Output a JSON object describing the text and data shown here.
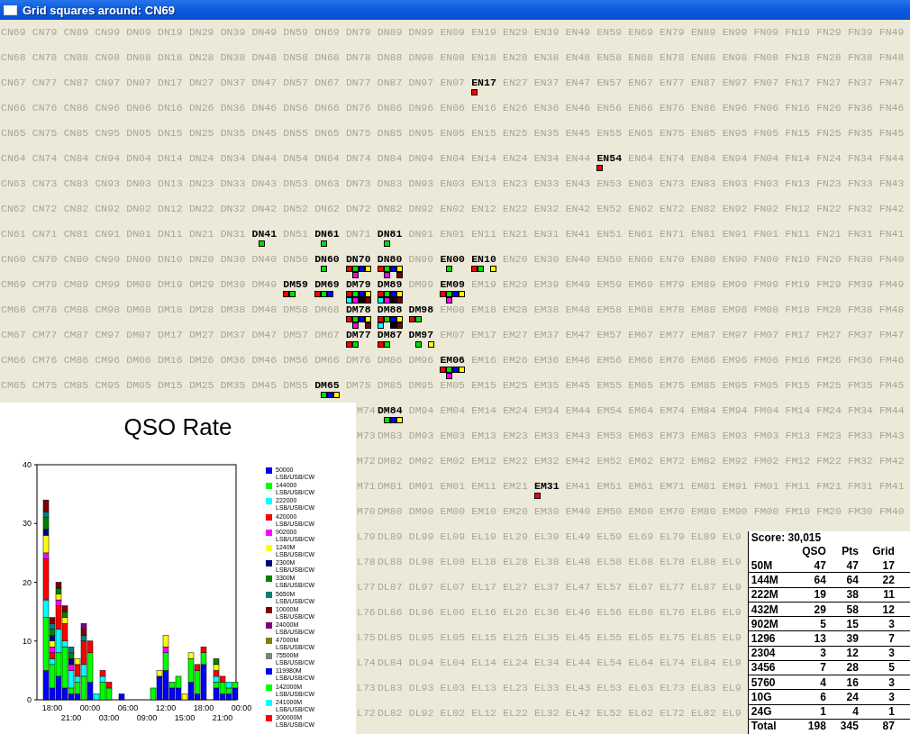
{
  "window": {
    "title": "Grid squares around: CN69"
  },
  "grid": {
    "top_rows": [
      [
        "CN69",
        "CN79",
        "CN89",
        "CN99",
        "DN09",
        "DN19",
        "DN29",
        "DN39",
        "DN49",
        "DN59",
        "DN69",
        "DN79",
        "DN89",
        "DN99",
        "EN09",
        "EN19",
        "EN29",
        "EN39",
        "EN49",
        "EN59",
        "EN69",
        "EN79",
        "EN89",
        "EN99",
        "FN09",
        "FN19",
        "FN29",
        "FN39",
        "FN49"
      ],
      [
        "CN68",
        "CN78",
        "CN88",
        "CN98",
        "DN08",
        "DN18",
        "DN28",
        "DN38",
        "DN48",
        "DN58",
        "DN68",
        "DN78",
        "DN88",
        "DN98",
        "EN08",
        "EN18",
        "EN28",
        "EN38",
        "EN48",
        "EN58",
        "EN68",
        "EN78",
        "EN88",
        "EN98",
        "FN08",
        "FN18",
        "FN28",
        "FN38",
        "FN48"
      ],
      [
        "CN67",
        "CN77",
        "CN87",
        "CN97",
        "DN07",
        "DN17",
        "DN27",
        "DN37",
        "DN47",
        "DN57",
        "DN67",
        "DN77",
        "DN87",
        "DN97",
        "EN07",
        {
          "label": "EN17",
          "marks": [
            {
              "kind": "square",
              "color": "#ff0000"
            }
          ]
        },
        "EN27",
        "EN37",
        "EN47",
        "EN57",
        "EN67",
        "EN77",
        "EN87",
        "EN97",
        "FN07",
        "FN17",
        "FN27",
        "FN37",
        "FN47"
      ],
      [
        "CN66",
        "CN76",
        "CN86",
        "CN96",
        "DN06",
        "DN16",
        "DN26",
        "DN36",
        "DN46",
        "DN56",
        "DN66",
        "DN76",
        "DN86",
        "DN96",
        "EN06",
        "EN16",
        "EN26",
        "EN36",
        "EN46",
        "EN56",
        "EN66",
        "EN76",
        "EN86",
        "EN96",
        "FN06",
        "FN16",
        "FN26",
        "FN36",
        "FN46"
      ],
      [
        "CN65",
        "CN75",
        "CN85",
        "CN95",
        "DN05",
        "DN15",
        "DN25",
        "DN35",
        "DN45",
        "DN55",
        "DN65",
        "DN75",
        "DN85",
        "DN95",
        "EN05",
        "EN15",
        "EN25",
        "EN35",
        "EN45",
        "EN55",
        "EN65",
        "EN75",
        "EN85",
        "EN95",
        "FN05",
        "FN15",
        "FN25",
        "FN35",
        "FN45"
      ],
      [
        "CN64",
        "CN74",
        "CN84",
        "CN94",
        "DN04",
        "DN14",
        "DN24",
        "DN34",
        "DN44",
        "DN54",
        "DN64",
        "DN74",
        "DN84",
        "DN94",
        "EN04",
        "EN14",
        "EN24",
        "EN34",
        "EN44",
        {
          "label": "EN54",
          "marks": [
            {
              "kind": "square",
              "color": "#ff0000"
            }
          ]
        },
        "EN64",
        "EN74",
        "EN84",
        "EN94",
        "FN04",
        "FN14",
        "FN24",
        "FN34",
        "FN44"
      ],
      [
        "CN63",
        "CN73",
        "CN83",
        "CN93",
        "DN03",
        "DN13",
        "DN23",
        "DN33",
        "DN43",
        "DN53",
        "DN63",
        "DN73",
        "DN83",
        "DN93",
        "EN03",
        "EN13",
        "EN23",
        "EN33",
        "EN43",
        "EN53",
        "EN63",
        "EN73",
        "EN83",
        "EN93",
        "FN03",
        "FN13",
        "FN23",
        "FN33",
        "FN43"
      ],
      [
        "CN62",
        "CN72",
        "CN82",
        "CN92",
        "DN02",
        "DN12",
        "DN22",
        "DN32",
        "DN42",
        "DN52",
        "DN62",
        "DN72",
        "DN82",
        "DN92",
        "EN02",
        "EN12",
        "EN22",
        "EN32",
        "EN42",
        "EN52",
        "EN62",
        "EN72",
        "EN82",
        "EN92",
        "FN02",
        "FN12",
        "FN22",
        "FN32",
        "FN42"
      ],
      [
        "CN61",
        "CN71",
        "CN81",
        "CN91",
        "DN01",
        "DN11",
        "DN21",
        "DN31",
        {
          "label": "DN41",
          "marks": [
            {
              "kind": "gap"
            },
            {
              "kind": "square",
              "color": "#00e000"
            }
          ]
        },
        "DN51",
        {
          "label": "DN61",
          "marks": [
            {
              "kind": "gap"
            },
            {
              "kind": "square",
              "color": "#00e000"
            }
          ]
        },
        "DN71",
        {
          "label": "DN81",
          "marks": [
            {
              "kind": "gap"
            },
            {
              "kind": "square",
              "color": "#00e000"
            }
          ]
        },
        "DN91",
        "EN01",
        "EN11",
        "EN21",
        "EN31",
        "EN41",
        "EN51",
        "EN61",
        "EN71",
        "EN81",
        "EN91",
        "FN01",
        "FN11",
        "FN21",
        "FN31",
        "FN41"
      ],
      [
        "CN60",
        "CN70",
        "CN80",
        "CN90",
        "DN00",
        "DN10",
        "DN20",
        "DN30",
        "DN40",
        "DN50",
        {
          "label": "DN60",
          "marks": [
            {
              "kind": "gap"
            },
            {
              "kind": "square",
              "color": "#00e000"
            }
          ]
        },
        {
          "label": "DN70",
          "marks": [
            {
              "kind": "square",
              "color": "#ff0000"
            },
            {
              "kind": "square",
              "color": "#00e000"
            },
            {
              "kind": "square",
              "color": "#0000ff"
            },
            {
              "kind": "square",
              "color": "#ffff00"
            },
            {
              "kind": "gap"
            },
            {
              "kind": "square",
              "color": "#ff00ff"
            }
          ]
        },
        {
          "label": "DN80",
          "marks": [
            {
              "kind": "square",
              "color": "#ff0000"
            },
            {
              "kind": "square",
              "color": "#00e000"
            },
            {
              "kind": "square",
              "color": "#0000ff"
            },
            {
              "kind": "square",
              "color": "#ffff00"
            },
            {
              "kind": "gap"
            },
            {
              "kind": "square",
              "color": "#ff00ff"
            },
            {
              "kind": "gap"
            },
            {
              "kind": "square",
              "color": "#800000"
            }
          ]
        },
        "DN90",
        {
          "label": "EN00",
          "marks": [
            {
              "kind": "gap"
            },
            {
              "kind": "square",
              "color": "#00e000"
            }
          ]
        },
        {
          "label": "EN10",
          "marks": [
            {
              "kind": "square",
              "color": "#ff0000"
            },
            {
              "kind": "square",
              "color": "#00e000"
            },
            {
              "kind": "gap"
            },
            {
              "kind": "square",
              "color": "#ffff00"
            }
          ]
        },
        "EN20",
        "EN30",
        "EN40",
        "EN50",
        "EN60",
        "EN70",
        "EN80",
        "EN90",
        "FN00",
        "FN10",
        "FN20",
        "FN30",
        "FN40"
      ],
      [
        "CM69",
        "CM79",
        "CM89",
        "CM99",
        "DM09",
        "DM19",
        "DM29",
        "DM39",
        "DM49",
        {
          "label": "DM59",
          "marks": [
            {
              "kind": "square",
              "color": "#ff0000"
            },
            {
              "kind": "square",
              "color": "#00e000"
            }
          ]
        },
        {
          "label": "DM69",
          "marks": [
            {
              "kind": "square",
              "color": "#ff0000"
            },
            {
              "kind": "square",
              "color": "#00e000"
            },
            {
              "kind": "square",
              "color": "#0000ff"
            }
          ]
        },
        {
          "label": "DM79",
          "marks": [
            {
              "kind": "square",
              "color": "#ff0000"
            },
            {
              "kind": "square",
              "color": "#00e000"
            },
            {
              "kind": "square",
              "color": "#0000ff"
            },
            {
              "kind": "square",
              "color": "#ffff00"
            },
            {
              "kind": "square",
              "color": "#00ffff"
            },
            {
              "kind": "square",
              "color": "#ff00ff"
            },
            {
              "kind": "square",
              "color": "#000000"
            },
            {
              "kind": "square",
              "color": "#800000"
            }
          ]
        },
        {
          "label": "DM89",
          "marks": [
            {
              "kind": "square",
              "color": "#ff0000"
            },
            {
              "kind": "square",
              "color": "#00e000"
            },
            {
              "kind": "square",
              "color": "#0000ff"
            },
            {
              "kind": "square",
              "color": "#ffff00"
            },
            {
              "kind": "square",
              "color": "#00ffff"
            },
            {
              "kind": "square",
              "color": "#ff00ff"
            },
            {
              "kind": "square",
              "color": "#000000"
            },
            {
              "kind": "square",
              "color": "#800000"
            }
          ]
        },
        "DM99",
        {
          "label": "EM09",
          "marks": [
            {
              "kind": "square",
              "color": "#ff0000"
            },
            {
              "kind": "square",
              "color": "#00e000"
            },
            {
              "kind": "square",
              "color": "#0000ff"
            },
            {
              "kind": "square",
              "color": "#ffff00"
            },
            {
              "kind": "gap"
            },
            {
              "kind": "square",
              "color": "#ff00ff"
            }
          ]
        },
        "EM19",
        "EM29",
        "EM39",
        "EM49",
        "EM59",
        "EM69",
        "EM79",
        "EM89",
        "EM99",
        "FM09",
        "FM19",
        "FM29",
        "FM39",
        "FM49"
      ],
      [
        "CM68",
        "CM78",
        "CM88",
        "CM98",
        "DM08",
        "DM18",
        "DM28",
        "DM38",
        "DM48",
        "DM58",
        "DM68",
        {
          "label": "DM78",
          "marks": [
            {
              "kind": "square",
              "color": "#ff0000"
            },
            {
              "kind": "square",
              "color": "#00e000"
            },
            {
              "kind": "square",
              "color": "#0000ff"
            },
            {
              "kind": "square",
              "color": "#ffff00"
            },
            {
              "kind": "gap"
            },
            {
              "kind": "square",
              "color": "#ff00ff"
            },
            {
              "kind": "gap"
            },
            {
              "kind": "square",
              "color": "#800000"
            }
          ]
        },
        {
          "label": "DM88",
          "marks": [
            {
              "kind": "square",
              "color": "#ff0000"
            },
            {
              "kind": "square",
              "color": "#00e000"
            },
            {
              "kind": "square",
              "color": "#0000ff"
            },
            {
              "kind": "square",
              "color": "#ffff00"
            },
            {
              "kind": "square",
              "color": "#00ffff"
            },
            {
              "kind": "gap"
            },
            {
              "kind": "square",
              "color": "#000000"
            },
            {
              "kind": "square",
              "color": "#800000"
            }
          ]
        },
        {
          "label": "DM98",
          "marks": [
            {
              "kind": "square",
              "color": "#ff0000"
            },
            {
              "kind": "square",
              "color": "#00e000"
            }
          ]
        },
        "EM08",
        "EM18",
        "EM28",
        "EM38",
        "EM48",
        "EM58",
        "EM68",
        "EM78",
        "EM88",
        "EM98",
        "FM08",
        "FM18",
        "FM28",
        "FM38",
        "FM48"
      ],
      [
        "CM67",
        "CM77",
        "CM87",
        "CM97",
        "DM07",
        "DM17",
        "DM27",
        "DM37",
        "DM47",
        "DM57",
        "DM67",
        {
          "label": "DM77",
          "marks": [
            {
              "kind": "square",
              "color": "#ff0000"
            },
            {
              "kind": "square",
              "color": "#00e000"
            }
          ]
        },
        {
          "label": "DM87",
          "marks": [
            {
              "kind": "square",
              "color": "#ff0000"
            },
            {
              "kind": "square",
              "color": "#00e000"
            }
          ]
        },
        {
          "label": "DM97",
          "marks": [
            {
              "kind": "gap"
            },
            {
              "kind": "square",
              "color": "#00e000"
            },
            {
              "kind": "gap"
            },
            {
              "kind": "square",
              "color": "#ffff00"
            }
          ]
        },
        "EM07",
        "EM17",
        "EM27",
        "EM37",
        "EM47",
        "EM57",
        "EM67",
        "EM77",
        "EM87",
        "EM97",
        "FM07",
        "FM17",
        "FM27",
        "FM37",
        "FM47"
      ],
      [
        "CM66",
        "CM76",
        "CM86",
        "CM96",
        "DM06",
        "DM16",
        "DM26",
        "DM36",
        "DM46",
        "DM56",
        "DM66",
        "DM76",
        "DM86",
        "DM96",
        {
          "label": "EM06",
          "marks": [
            {
              "kind": "square",
              "color": "#ff0000"
            },
            {
              "kind": "square",
              "color": "#00e000"
            },
            {
              "kind": "square",
              "color": "#0000ff"
            },
            {
              "kind": "square",
              "color": "#ffff00"
            },
            {
              "kind": "gap"
            },
            {
              "kind": "square",
              "color": "#ff00ff"
            }
          ]
        },
        "EM16",
        "EM26",
        "EM36",
        "EM46",
        "EM56",
        "EM66",
        "EM76",
        "EM86",
        "EM96",
        "FM06",
        "FM16",
        "FM26",
        "FM36",
        "FM46"
      ],
      [
        "CM65",
        "CM75",
        "CM85",
        "CM95",
        "DM05",
        "DM15",
        "DM25",
        "DM35",
        "DM45",
        "DM55",
        {
          "label": "DM65",
          "marks": [
            {
              "kind": "gap"
            },
            {
              "kind": "square",
              "color": "#00e000"
            },
            {
              "kind": "square",
              "color": "#0000ff"
            },
            {
              "kind": "square",
              "color": "#ffff00"
            }
          ]
        },
        "DM75",
        "DM85",
        "DM95",
        "EM05",
        "EM15",
        "EM25",
        "EM35",
        "EM45",
        "EM55",
        "EM65",
        "EM75",
        "EM85",
        "EM95",
        "FM05",
        "FM15",
        "FM25",
        "FM35",
        "FM45"
      ]
    ],
    "lower_rows": [
      [
        "M74",
        {
          "label": "DM84",
          "marks": [
            {
              "kind": "gap"
            },
            {
              "kind": "square",
              "color": "#00e000"
            },
            {
              "kind": "square",
              "color": "#0000ff"
            },
            {
              "kind": "square",
              "color": "#ffff00"
            }
          ]
        },
        "DM94",
        "EM04",
        "EM14",
        "EM24",
        "EM34",
        "EM44",
        "EM54",
        "EM64",
        "EM74",
        "EM84",
        "EM94",
        "FM04",
        "FM14",
        "FM24",
        "FM34",
        "FM44"
      ],
      [
        "M73",
        "DM83",
        "DM93",
        "EM03",
        "EM13",
        "EM23",
        "EM33",
        "EM43",
        "EM53",
        "EM63",
        "EM73",
        "EM83",
        "EM93",
        "FM03",
        "FM13",
        "FM23",
        "FM33",
        "FM43"
      ],
      [
        "M72",
        "DM82",
        "DM92",
        "EM02",
        "EM12",
        "EM22",
        "EM32",
        "EM42",
        "EM52",
        "EM62",
        "EM72",
        "EM82",
        "EM92",
        "FM02",
        "FM12",
        "FM22",
        "FM32",
        "FM42"
      ],
      [
        "M71",
        "DM81",
        "DM91",
        "EM01",
        "EM11",
        "EM21",
        {
          "label": "EM31",
          "marks": [
            {
              "kind": "square",
              "color": "#ff0000"
            }
          ]
        },
        "EM41",
        "EM51",
        "EM61",
        "EM71",
        "EM81",
        "EM91",
        "FM01",
        "FM11",
        "FM21",
        "FM31",
        "FM41"
      ],
      [
        "M70",
        "DM80",
        "DM90",
        "EM00",
        "EM10",
        "EM20",
        "EM30",
        "EM40",
        "EM50",
        "EM60",
        "EM70",
        "EM80",
        "EM90",
        "FM00",
        "FM10",
        "FM20",
        "FM30",
        "FM40"
      ]
    ],
    "bottom_rows": [
      [
        "L79",
        "DL89",
        "DL99",
        "EL09",
        "EL19",
        "EL29",
        "EL39",
        "EL49",
        "EL59",
        "EL69",
        "EL79",
        "EL89",
        "EL9"
      ],
      [
        "L78",
        "DL88",
        "DL98",
        "EL08",
        "EL18",
        "EL28",
        "EL38",
        "EL48",
        "EL58",
        "EL68",
        "EL78",
        "EL88",
        "EL9"
      ],
      [
        "L77",
        "DL87",
        "DL97",
        "EL07",
        "EL17",
        "EL27",
        "EL37",
        "EL47",
        "EL57",
        "EL67",
        "EL77",
        "EL87",
        "EL9"
      ],
      [
        "L76",
        "DL86",
        "DL96",
        "EL06",
        "EL16",
        "EL26",
        "EL36",
        "EL46",
        "EL56",
        "EL66",
        "EL76",
        "EL86",
        "EL9"
      ],
      [
        "L75",
        "DL85",
        "DL95",
        "EL05",
        "EL15",
        "EL25",
        "EL35",
        "EL45",
        "EL55",
        "EL65",
        "EL75",
        "EL85",
        "EL9"
      ],
      [
        "L74",
        "DL84",
        "DL94",
        "EL04",
        "EL14",
        "EL24",
        "EL34",
        "EL44",
        "EL54",
        "EL64",
        "EL74",
        "EL84",
        "EL9"
      ],
      [
        "L73",
        "DL83",
        "DL93",
        "EL03",
        "EL13",
        "EL23",
        "EL33",
        "EL43",
        "EL53",
        "EL63",
        "EL73",
        "EL83",
        "EL9"
      ],
      [
        "L72",
        "DL82",
        "DL92",
        "EL02",
        "EL12",
        "EL22",
        "EL32",
        "EL42",
        "EL52",
        "EL62",
        "EL72",
        "EL82",
        "EL9"
      ]
    ]
  },
  "qso_rate": {
    "chart_data": {
      "type": "bar",
      "stacked": true,
      "title": "QSO Rate",
      "categories": [
        null,
        "18:00",
        null,
        null,
        "21:00",
        null,
        null,
        "00:00",
        null,
        null,
        "03:00",
        null,
        null,
        "06:00",
        null,
        null,
        "09:00",
        null,
        null,
        "12:00",
        null,
        null,
        "15:00",
        null,
        null,
        "18:00",
        null,
        null,
        "21:00",
        null,
        null,
        "00:00"
      ],
      "ylim": [
        0,
        40
      ],
      "yticks": [
        0,
        10,
        20,
        30,
        40
      ],
      "series": [
        {
          "name": "50000 LSB/USB/CW",
          "color": "#0000ff",
          "values": [
            5,
            2,
            4,
            2,
            1,
            1,
            0,
            3,
            0,
            0,
            0,
            0,
            1,
            0,
            0,
            0,
            0,
            0,
            4,
            5,
            2,
            2,
            0,
            3,
            1,
            6,
            0,
            2,
            1,
            1,
            2,
            null
          ]
        },
        {
          "name": "144000 LSB/USB/CW",
          "color": "#00ff00",
          "values": [
            9,
            4,
            4,
            7,
            1,
            2,
            4,
            5,
            0,
            3,
            2,
            0,
            0,
            0,
            0,
            0,
            0,
            2,
            0,
            3,
            1,
            2,
            0,
            4,
            4,
            2,
            0,
            1,
            2,
            1,
            1,
            null
          ]
        },
        {
          "name": "222000 LSB/USB/CW",
          "color": "#00ffff",
          "values": [
            3,
            1,
            4,
            1,
            3,
            1,
            2,
            0,
            1,
            1,
            0,
            0,
            0,
            0,
            0,
            0,
            0,
            0,
            0,
            0,
            0,
            0,
            0,
            0,
            0,
            0,
            0,
            1,
            0,
            1,
            0,
            null
          ]
        },
        {
          "name": "420000 LSB/USB/CW",
          "color": "#ff0000",
          "values": [
            7,
            1,
            4,
            3,
            0,
            2,
            4,
            2,
            0,
            1,
            1,
            0,
            0,
            0,
            0,
            0,
            0,
            0,
            0,
            0,
            0,
            0,
            0,
            0,
            1,
            1,
            0,
            1,
            1,
            0,
            0,
            null
          ]
        },
        {
          "name": "902000 LSB/USB/CW",
          "color": "#ff00ff",
          "values": [
            1,
            1,
            1,
            0,
            1,
            0,
            0,
            0,
            0,
            0,
            0,
            0,
            0,
            0,
            0,
            0,
            0,
            0,
            0,
            1,
            0,
            0,
            0,
            0,
            0,
            0,
            0,
            0,
            0,
            0,
            0,
            null
          ]
        },
        {
          "name": "1240M LSB/USB/CW",
          "color": "#ffff00",
          "values": [
            3,
            1,
            1,
            1,
            0,
            1,
            0,
            0,
            0,
            0,
            0,
            0,
            0,
            0,
            0,
            0,
            0,
            0,
            1,
            2,
            0,
            0,
            1,
            1,
            0,
            0,
            0,
            1,
            0,
            0,
            0,
            null
          ]
        },
        {
          "name": "2300M LSB/USB/CW",
          "color": "#000080",
          "values": [
            1,
            1,
            0,
            0,
            1,
            0,
            0,
            0,
            0,
            0,
            0,
            0,
            0,
            0,
            0,
            0,
            0,
            0,
            0,
            0,
            0,
            0,
            0,
            0,
            0,
            0,
            0,
            0,
            0,
            0,
            0,
            null
          ]
        },
        {
          "name": "3300M LSB/USB/CW",
          "color": "#008000",
          "values": [
            2,
            1,
            1,
            1,
            1,
            0,
            0,
            0,
            0,
            0,
            0,
            0,
            0,
            0,
            0,
            0,
            0,
            0,
            0,
            0,
            0,
            0,
            0,
            0,
            0,
            0,
            0,
            1,
            0,
            0,
            0,
            null
          ]
        },
        {
          "name": "5650M LSB/USB/CW",
          "color": "#008080",
          "values": [
            1,
            1,
            0,
            0,
            1,
            0,
            1,
            0,
            0,
            0,
            0,
            0,
            0,
            0,
            0,
            0,
            0,
            0,
            0,
            0,
            0,
            0,
            0,
            0,
            0,
            0,
            0,
            0,
            0,
            0,
            0,
            null
          ]
        },
        {
          "name": "10000M LSB/USB/CW",
          "color": "#800000",
          "values": [
            2,
            1,
            1,
            1,
            0,
            0,
            1,
            0,
            0,
            0,
            0,
            0,
            0,
            0,
            0,
            0,
            0,
            0,
            0,
            0,
            0,
            0,
            0,
            0,
            0,
            0,
            0,
            0,
            0,
            0,
            0,
            null
          ]
        },
        {
          "name": "24000M LSB/USB/CW",
          "color": "#800080",
          "values": [
            0,
            0,
            0,
            0,
            0,
            0,
            1,
            0,
            0,
            0,
            0,
            0,
            0,
            0,
            0,
            0,
            0,
            0,
            0,
            0,
            0,
            0,
            0,
            0,
            0,
            0,
            0,
            0,
            0,
            0,
            0,
            null
          ]
        },
        {
          "name": "47000M LSB/USB/CW",
          "color": "#808000",
          "values": [
            0,
            0,
            0,
            0,
            0,
            0,
            0,
            0,
            0,
            0,
            0,
            0,
            0,
            0,
            0,
            0,
            0,
            0,
            0,
            0,
            0,
            0,
            0,
            0,
            0,
            0,
            0,
            0,
            0,
            0,
            0,
            null
          ]
        },
        {
          "name": "75500M LSB/USB/CW",
          "color": "#808080",
          "values": [
            0,
            0,
            0,
            0,
            0,
            0,
            0,
            0,
            0,
            0,
            0,
            0,
            0,
            0,
            0,
            0,
            0,
            0,
            0,
            0,
            0,
            0,
            0,
            0,
            0,
            0,
            0,
            0,
            0,
            0,
            0,
            null
          ]
        },
        {
          "name": "119980M LSB/USB/CW",
          "color": "#0000ff",
          "values": [
            0,
            0,
            0,
            0,
            0,
            0,
            0,
            0,
            0,
            0,
            0,
            0,
            0,
            0,
            0,
            0,
            0,
            0,
            0,
            0,
            0,
            0,
            0,
            0,
            0,
            0,
            0,
            0,
            0,
            0,
            0,
            null
          ]
        },
        {
          "name": "142000M LSB/USB/CW",
          "color": "#00ff00",
          "values": [
            0,
            0,
            0,
            0,
            0,
            0,
            0,
            0,
            0,
            0,
            0,
            0,
            0,
            0,
            0,
            0,
            0,
            0,
            0,
            0,
            0,
            0,
            0,
            0,
            0,
            0,
            0,
            0,
            0,
            0,
            0,
            null
          ]
        },
        {
          "name": "241000M LSB/USB/CW",
          "color": "#00ffff",
          "values": [
            0,
            0,
            0,
            0,
            0,
            0,
            0,
            0,
            0,
            0,
            0,
            0,
            0,
            0,
            0,
            0,
            0,
            0,
            0,
            0,
            0,
            0,
            0,
            0,
            0,
            0,
            0,
            0,
            0,
            0,
            0,
            null
          ]
        },
        {
          "name": "300000M LSB/USB/CW",
          "color": "#ff0000",
          "values": [
            0,
            0,
            0,
            0,
            0,
            0,
            0,
            0,
            0,
            0,
            0,
            0,
            0,
            0,
            0,
            0,
            0,
            0,
            0,
            0,
            0,
            0,
            0,
            0,
            0,
            0,
            0,
            0,
            0,
            0,
            0,
            null
          ]
        }
      ]
    }
  },
  "score": {
    "title": "Score: 30,015",
    "columns": [
      "QSO",
      "Pts",
      "Grid"
    ],
    "rows": [
      {
        "band": "50M",
        "qso": "47",
        "pts": "47",
        "grid": "17"
      },
      {
        "band": "144M",
        "qso": "64",
        "pts": "64",
        "grid": "22"
      },
      {
        "band": "222M",
        "qso": "19",
        "pts": "38",
        "grid": "11"
      },
      {
        "band": "432M",
        "qso": "29",
        "pts": "58",
        "grid": "12"
      },
      {
        "band": "902M",
        "qso": "5",
        "pts": "15",
        "grid": "3"
      },
      {
        "band": "1296",
        "qso": "13",
        "pts": "39",
        "grid": "7"
      },
      {
        "band": "2304",
        "qso": "3",
        "pts": "12",
        "grid": "3"
      },
      {
        "band": "3456",
        "qso": "7",
        "pts": "28",
        "grid": "5"
      },
      {
        "band": "5760",
        "qso": "4",
        "pts": "16",
        "grid": "3"
      },
      {
        "band": "10G",
        "qso": "6",
        "pts": "24",
        "grid": "3"
      },
      {
        "band": "24G",
        "qso": "1",
        "pts": "4",
        "grid": "1"
      },
      {
        "band": "Total",
        "qso": "198",
        "pts": "345",
        "grid": "87"
      }
    ]
  }
}
